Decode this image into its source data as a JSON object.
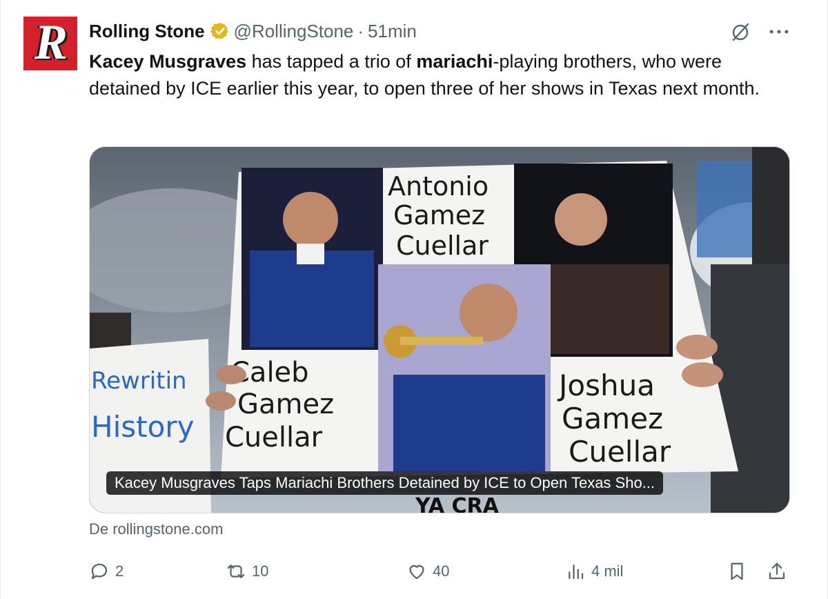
{
  "tweet": {
    "display_name": "Rolling Stone",
    "handle": "@RollingStone",
    "separator": "·",
    "time": "51min",
    "avatar_letter": "R",
    "text_parts": {
      "bold1": "Kacey Musgraves",
      "plain1": " has tapped a trio of ",
      "bold2": "mariachi",
      "plain2": "-playing brothers, who were detained by ICE earlier this year, to open three of her shows in Texas next month."
    },
    "card": {
      "caption": "Kacey Musgraves Taps Mariachi Brothers Detained by ICE to Open Texas Sho...",
      "sign_names": {
        "antonio": [
          "Antonio",
          "Gamez",
          "Cuellar"
        ],
        "caleb": [
          "Caleb",
          "Gamez",
          "Cuellar"
        ],
        "joshua": [
          "Joshua",
          "Gamez",
          "Cuellar"
        ]
      },
      "left_sign": [
        "Rewritin",
        "History"
      ],
      "bottom_sign": "YA CRA"
    },
    "source": "De rollingstone.com",
    "actions": {
      "replies": "2",
      "retweets": "10",
      "likes": "40",
      "views": "4 mil"
    }
  },
  "colors": {
    "brand_red": "#d3202a",
    "verified_gold": "#e2b719",
    "muted": "#536471"
  },
  "icons": [
    "grok-icon",
    "more-icon",
    "verified-icon",
    "reply-icon",
    "retweet-icon",
    "like-icon",
    "views-icon",
    "bookmark-icon",
    "share-icon"
  ]
}
